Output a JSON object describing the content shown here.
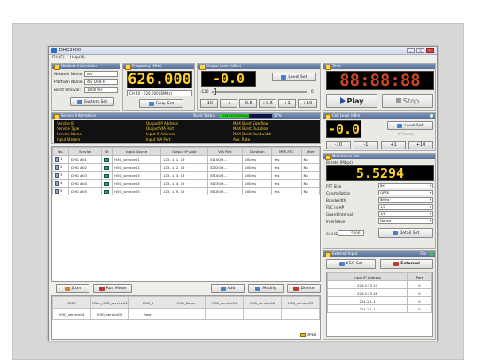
{
  "window": {
    "title": "DHG2000",
    "menu": [
      "File(F)",
      "Help(H)"
    ]
  },
  "network": {
    "header": "Network Information",
    "labels": [
      "Network Name:",
      "Platform Name:",
      "Burst Interval:"
    ],
    "values": [
      "dtv",
      "dtv DVB-H",
      "1000 ms"
    ],
    "button": "System Set"
  },
  "frequency": {
    "header": "Frequency (MHz)",
    "display": "626.000",
    "select": "CH 40 : 626.000 (8MHz)",
    "button": "Freq. Set"
  },
  "level": {
    "header": "Output Level (dBm)",
    "display": "-0.0",
    "button": "Level Set",
    "slider_min": "-120",
    "slider_max": "0",
    "steps": [
      "-10",
      "-1",
      "-0.5",
      "+0.5",
      "+1",
      "+10"
    ]
  },
  "clock": {
    "header": "Time",
    "display": "88:88:88",
    "play": "Play",
    "stop": "Stop"
  },
  "service_info": {
    "header": "Service Information",
    "burst_label": "Burst Status",
    "burst_value": "14493/25000kbps",
    "burst_percent": "57",
    "burst_fraction": 0.57,
    "col1": [
      "Service ID",
      "Service Type",
      "Service Name",
      "Input Stream"
    ],
    "col2": [
      "Output IP Address",
      "Output VIA Port",
      "Input IP Address",
      "Input VIA Port"
    ],
    "col3": [
      "MAX Burst Size Row",
      "MAX Burst Duration",
      "MAX Burst Bandwidth",
      "Ave. Rate"
    ]
  },
  "services_table": {
    "columns": [
      "No.",
      "Service",
      "St",
      "Input Source",
      "Output IP Addr",
      "V/A Port",
      "Duration",
      "MPE-FEC",
      "Jitter"
    ],
    "rows": [
      [
        "1",
        "DHG #01",
        "H3G_service01",
        "225. 1. 1. 19",
        "31100/3...",
        "200ms",
        "Yes",
        "No"
      ],
      [
        "2",
        "DHG #02",
        "H3G_service02",
        "225. 1. 2. 19",
        "32020/3...",
        "200ms",
        "Yes",
        "No"
      ],
      [
        "3",
        "DHG #03",
        "H3G_service03",
        "225. 1. 3. 19",
        "33100/3...",
        "200ms",
        "Yes",
        "No"
      ],
      [
        "4",
        "DHG #04",
        "H3G_service04",
        "225. 1. 4. 19",
        "34230/3...",
        "200ms",
        "Yes",
        "No"
      ],
      [
        "5",
        "DHG #05",
        "H3G_service05",
        "225. 1. 5. 19",
        "35100/3...",
        "200ms",
        "Yes",
        "No"
      ]
    ]
  },
  "service_buttons": {
    "jitter": "Jitter",
    "run_mode": "Run Mode",
    "add": "Add",
    "modify": "Modify",
    "delete": "Delete"
  },
  "bottom_table": {
    "columns": [
      "EMM",
      "Filter_H3G_service01",
      "H3G_1",
      "H3G_Rome",
      "H3G_service01",
      "H3G_service02",
      "H3G_service03"
    ],
    "row": [
      "H3G_service04",
      "H3G_service05",
      "test",
      "",
      "",
      "",
      ""
    ],
    "open": "OPEN"
  },
  "cell_level": {
    "header": "Cell Level (dBm)",
    "display": "-0.0",
    "button": "Level Set",
    "option": "IP Ready",
    "steps": [
      "-10",
      "-1",
      "+1",
      "+10"
    ]
  },
  "modulation": {
    "header": "Modulation Set",
    "bitrate_label": "Bitrate (Mbps)",
    "bitrate": "5.5294",
    "labels": [
      "FFT Size",
      "Constellation",
      "Bandwidth",
      "FEC in HP",
      "Guard Interval",
      "Interleave"
    ],
    "values": [
      "8K",
      "QPSK",
      "8MHz",
      "1/2",
      "1/8",
      "Native"
    ],
    "cell_id_label": "Cell ID:",
    "cell_id": "50001",
    "button": "Detail Set"
  },
  "external": {
    "header": "External Input",
    "file_label": "File",
    "ksg_button": "KSG Set",
    "ext_button": "External",
    "columns": [
      "Input IP Address",
      "Port"
    ],
    "rows": [
      [
        "224.0.23.14",
        "0"
      ],
      [
        "224.0.23.16",
        "0"
      ],
      [
        "224.1.1.1",
        "0"
      ],
      [
        "224.1.1.1",
        "0"
      ]
    ]
  },
  "colors": {
    "segment": "#ffcf2e",
    "header": "#56709a",
    "burst_bar": "#2fcf2f"
  }
}
